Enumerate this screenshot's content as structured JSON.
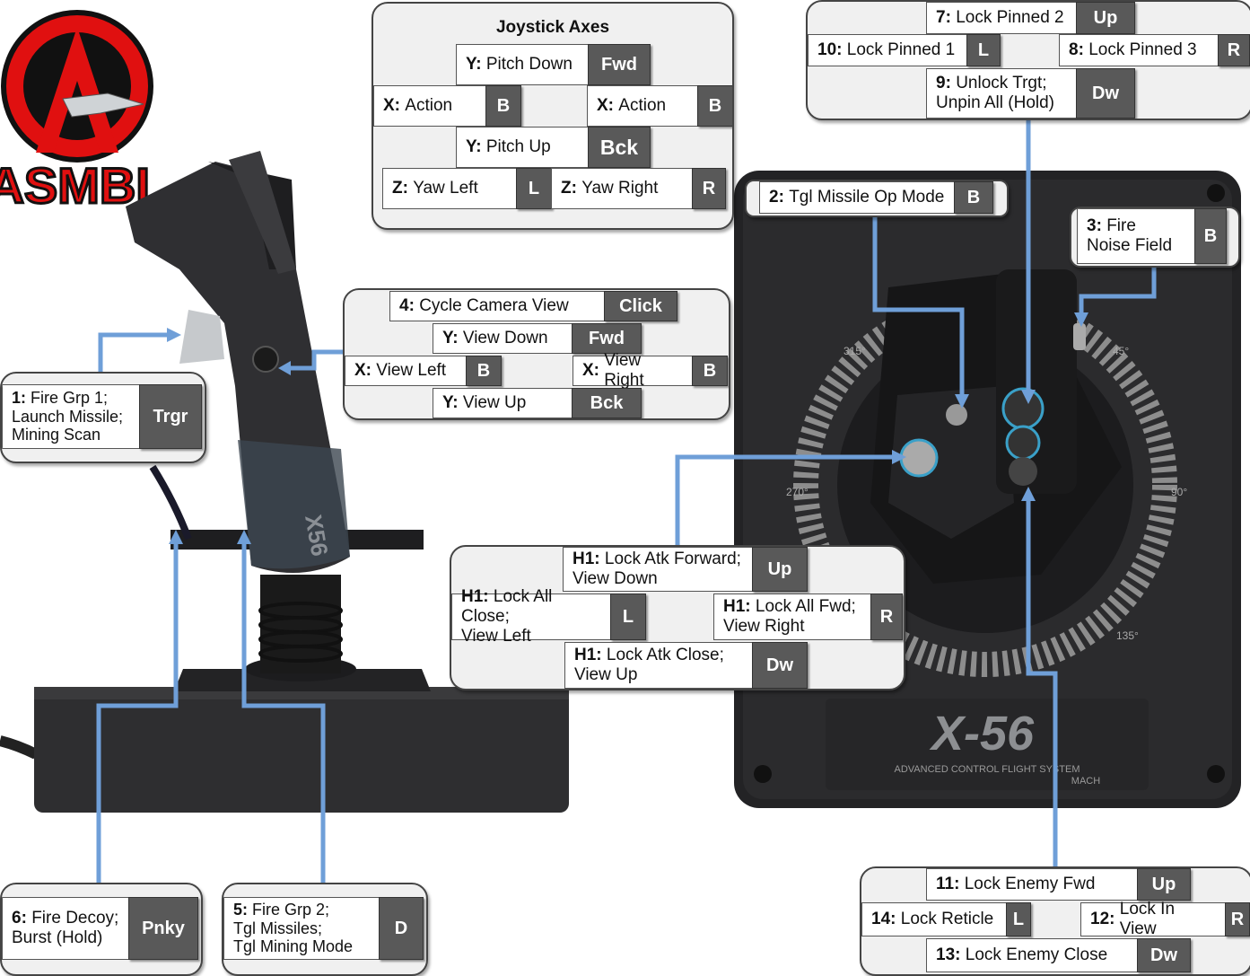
{
  "logo": {
    "letter": "A",
    "text": "ASMBL"
  },
  "device_text": {
    "stick_brand": "X56",
    "throttle_brand": "X-56",
    "throttle_sub1": "ADVANCED CONTROL FLIGHT SYSTEM",
    "throttle_sub2": "MACH",
    "dial_315": "315°",
    "dial_45": "45°",
    "dial_270": "270°",
    "dial_90": "90°",
    "dial_135": "135°"
  },
  "joystick_axes": {
    "title": "Joystick Axes",
    "pitch_down": {
      "axis": "Y:",
      "label": "Pitch Down",
      "key": "Fwd"
    },
    "action_left": {
      "axis": "X:",
      "label": "Action",
      "key": "B"
    },
    "action_right": {
      "axis": "X:",
      "label": "Action",
      "key": "B"
    },
    "pitch_up": {
      "axis": "Y:",
      "label": "Pitch Up",
      "key": "Bck"
    },
    "yaw_left": {
      "axis": "Z:",
      "label": "Yaw Left",
      "key": "L"
    },
    "yaw_right": {
      "axis": "Z:",
      "label": "Yaw Right",
      "key": "R"
    }
  },
  "hat4": {
    "main": {
      "num": "4:",
      "label": "Cycle Camera View",
      "key": "Click"
    },
    "down": {
      "axis": "Y:",
      "label": "View Down",
      "key": "Fwd"
    },
    "left": {
      "axis": "X:",
      "label": "View Left",
      "key": "B"
    },
    "right": {
      "axis": "X:",
      "label": "View Right",
      "key": "B"
    },
    "up": {
      "axis": "Y:",
      "label": "View Up",
      "key": "Bck"
    }
  },
  "button1": {
    "num": "1:",
    "line1": "Fire Grp 1;",
    "line2": "Launch Missile;",
    "line3": "Mining Scan",
    "key": "Trgr"
  },
  "button6": {
    "num": "6:",
    "line1": "Fire Decoy;",
    "line2": "Burst (Hold)",
    "key": "Pnky"
  },
  "button5": {
    "num": "5:",
    "line1": "Fire Grp 2;",
    "line2": "Tgl Missiles;",
    "line3": "Tgl Mining Mode",
    "key": "D"
  },
  "hat_top": {
    "up": {
      "num": "7:",
      "label": "Lock Pinned 2",
      "key": "Up"
    },
    "left": {
      "num": "10:",
      "label": "Lock Pinned 1",
      "key": "L"
    },
    "right": {
      "num": "8:",
      "label": "Lock Pinned 3",
      "key": "R"
    },
    "down": {
      "num": "9:",
      "line1": "Unlock Trgt;",
      "line2": "Unpin All (Hold)",
      "key": "Dw"
    }
  },
  "button2": {
    "num": "2:",
    "label": "Tgl Missile Op Mode",
    "key": "B"
  },
  "button3": {
    "num": "3:",
    "line1": "Fire",
    "line2": "Noise Field",
    "key": "B"
  },
  "hat_h1": {
    "up": {
      "num": "H1:",
      "line1": "Lock Atk Forward;",
      "line2": "View Down",
      "key": "Up"
    },
    "left": {
      "num": "H1:",
      "line1": "Lock All Close;",
      "line2": "View Left",
      "key": "L"
    },
    "right": {
      "num": "H1:",
      "line1": "Lock All Fwd;",
      "line2": "View Right",
      "key": "R"
    },
    "down": {
      "num": "H1:",
      "line1": "Lock Atk Close;",
      "line2": "View Up",
      "key": "Dw"
    }
  },
  "hat_bottom": {
    "up": {
      "num": "11:",
      "label": "Lock Enemy Fwd",
      "key": "Up"
    },
    "left": {
      "num": "14:",
      "label": "Lock Reticle",
      "key": "L"
    },
    "right": {
      "num": "12:",
      "label": "Lock In View",
      "key": "R"
    },
    "down": {
      "num": "13:",
      "label": "Lock Enemy Close",
      "key": "Dw"
    }
  },
  "colors": {
    "connector": "#6f9fd8",
    "key_bg": "#595959",
    "logo_red": "#e01010",
    "device_dark": "#2b2b2d"
  }
}
